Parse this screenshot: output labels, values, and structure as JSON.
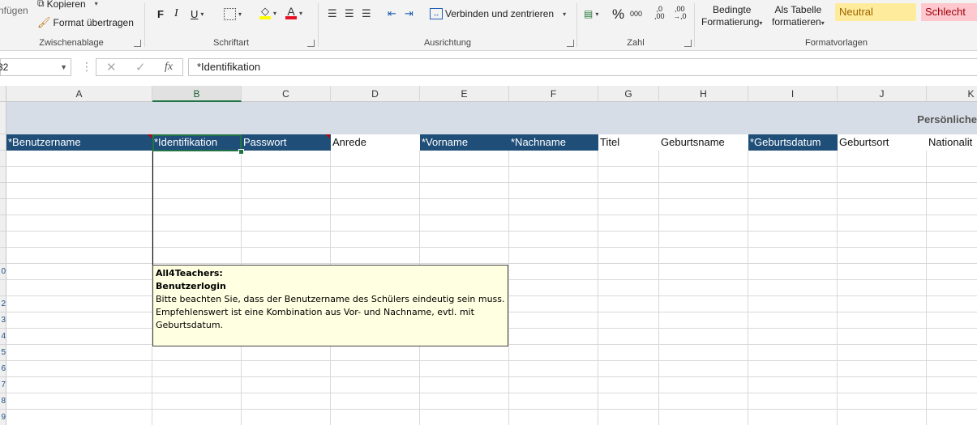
{
  "ribbon": {
    "clipboard": {
      "paste_label": "nfügen",
      "copy_label": "Kopieren",
      "format_painter_label": "Format übertragen",
      "group_label": "Zwischenablage"
    },
    "font": {
      "bold": "F",
      "italic": "I",
      "underline": "U",
      "group_label": "Schriftart",
      "font_color": "#e81123",
      "fill_color": "#ffff00"
    },
    "alignment": {
      "merge_label": "Verbinden und zentrieren",
      "group_label": "Ausrichtung"
    },
    "number": {
      "percent": "%",
      "thousands": "000",
      "inc_decimals_top": ",0",
      "inc_decimals_bottom": ",00",
      "dec_decimals_top": ",00",
      "dec_decimals_bottom": "→,0",
      "group_label": "Zahl"
    },
    "styles": {
      "conditional_line1": "Bedingte",
      "conditional_line2": "Formatierung",
      "table_line1": "Als Tabelle",
      "table_line2": "formatieren",
      "neutral_label": "Neutral",
      "neutral_bg": "#ffeb9c",
      "neutral_fg": "#9c6500",
      "bad_label": "Schlecht",
      "bad_bg": "#ffc7ce",
      "bad_fg": "#9c0006",
      "group_label": "Formatvorlagen"
    }
  },
  "formula_bar": {
    "name_box": "32",
    "cancel_icon": "✕",
    "enter_icon": "✓",
    "fx_label": "fx",
    "content": "*Identifikation"
  },
  "columns": [
    "A",
    "B",
    "C",
    "D",
    "E",
    "F",
    "G",
    "H",
    "I",
    "J",
    "K"
  ],
  "selected_column": "B",
  "row_numbers": [
    "",
    "",
    "",
    "",
    "",
    "",
    "",
    "",
    "",
    "0",
    "",
    "2",
    "3",
    "4",
    "5",
    "6",
    "7",
    "8",
    "9"
  ],
  "title_band": "Persönliche",
  "header_cells": [
    {
      "text": "*Benutzername",
      "style": "dark"
    },
    {
      "text": "*Identifikation",
      "style": "dark"
    },
    {
      "text": "Passwort",
      "style": "dark"
    },
    {
      "text": "Anrede",
      "style": "light"
    },
    {
      "text": "*Vorname",
      "style": "dark"
    },
    {
      "text": "*Nachname",
      "style": "dark"
    },
    {
      "text": "Titel",
      "style": "light"
    },
    {
      "text": "Geburtsname",
      "style": "light"
    },
    {
      "text": "*Geburtsdatum",
      "style": "dark"
    },
    {
      "text": "Geburtsort",
      "style": "light"
    },
    {
      "text": "Nationalit",
      "style": "light"
    }
  ],
  "header_dark_color": "#1f4e79",
  "comment": {
    "author": "All4Teachers:",
    "title": "Benutzerlogin",
    "body_line1": "Bitte beachten Sie, dass der Benutzername des Schülers eindeutig sein muss.",
    "body_line2": "Empfehlenswert ist eine Kombination aus Vor- und Nachname, evtl. mit",
    "body_line3": "Geburtsdatum."
  }
}
